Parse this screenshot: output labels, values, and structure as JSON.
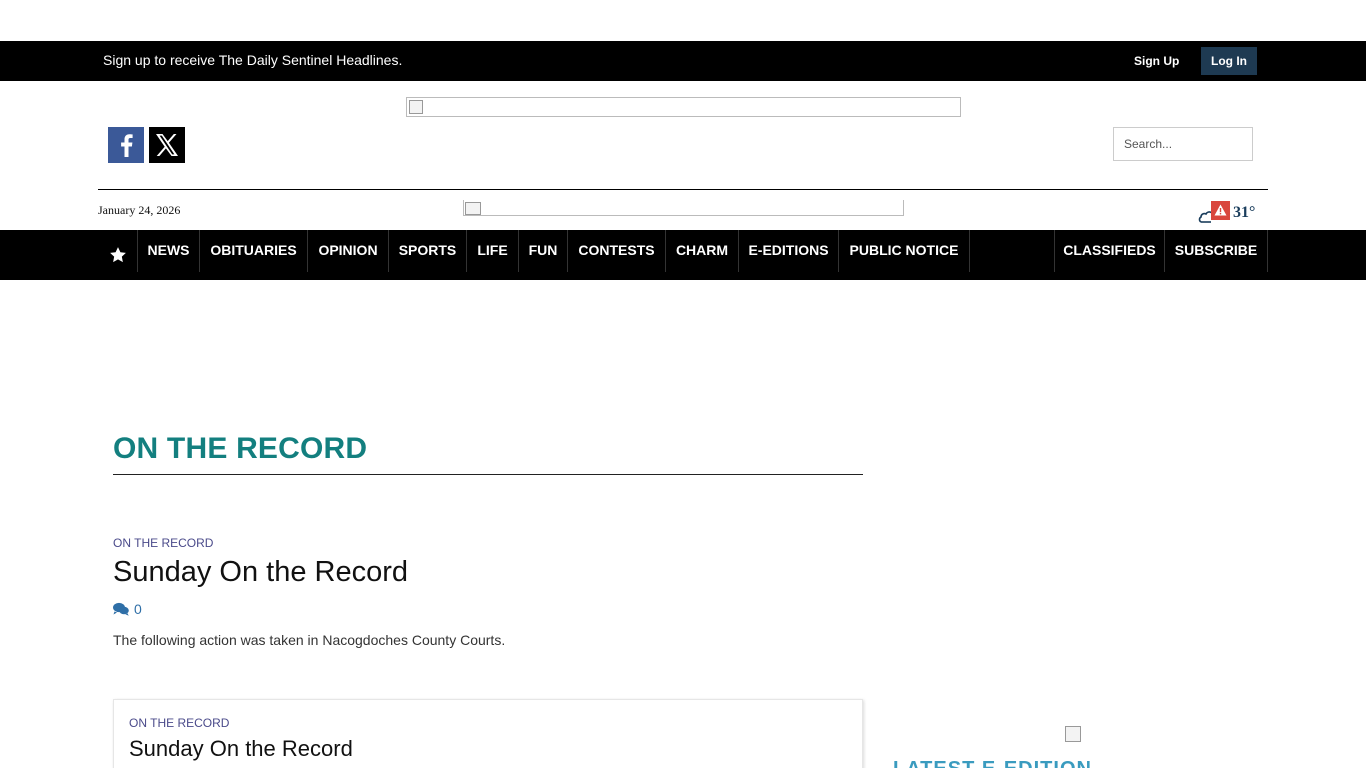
{
  "topbar": {
    "message": "Sign up to receive The Daily Sentinel Headlines.",
    "signup_label": "Sign Up",
    "login_label": "Log In"
  },
  "header": {
    "search_placeholder": "Search...",
    "date": "January 24, 2026",
    "weather_temp": "31°"
  },
  "nav": {
    "items": [
      "NEWS",
      "OBITUARIES",
      "OPINION",
      "SPORTS",
      "LIFE",
      "FUN",
      "CONTESTS",
      "CHARM",
      "E-EDITIONS",
      "PUBLIC NOTICE"
    ],
    "right_items": [
      "CLASSIFIEDS",
      "SUBSCRIBE"
    ]
  },
  "section": {
    "title": "ON THE RECORD"
  },
  "articles": [
    {
      "kicker": "ON THE RECORD",
      "headline": "Sunday On the Record",
      "comment_count": "0",
      "summary": "The following action was taken in Nacogdoches County Courts."
    },
    {
      "kicker": "ON THE RECORD",
      "headline": "Sunday On the Record"
    }
  ],
  "sidebar": {
    "heading": "LATEST E-EDITION"
  },
  "colors": {
    "section_title": "#137f7f",
    "login_bg": "#1e3a52",
    "facebook": "#3b5998",
    "kicker": "#4a4a8a",
    "comment_icon": "#2f6fa7"
  }
}
